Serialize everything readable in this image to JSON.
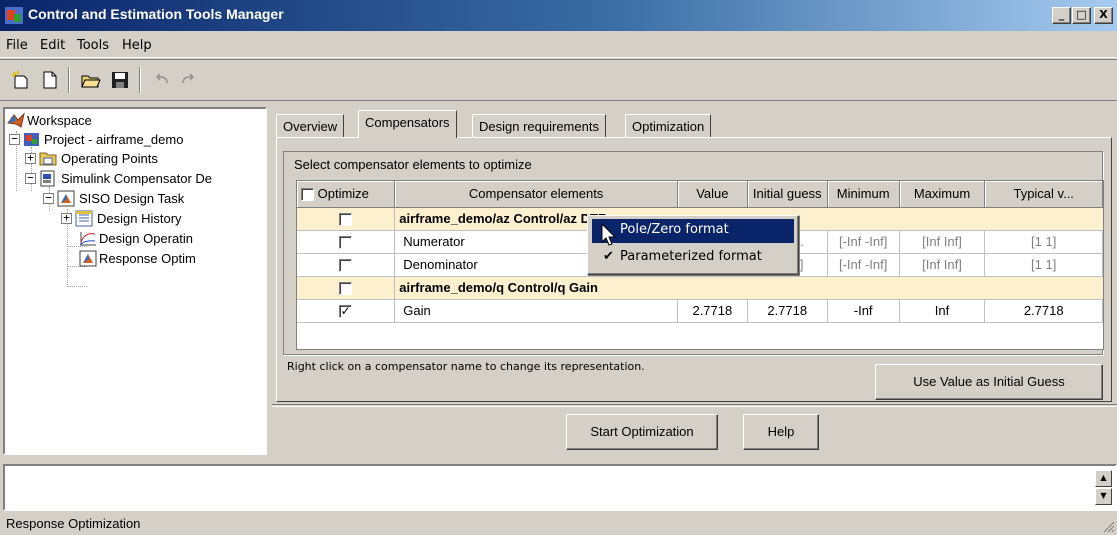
{
  "window": {
    "title": "Control and Estimation Tools Manager",
    "minimize": "_",
    "maximize": "□",
    "close": "X"
  },
  "menu": [
    "File",
    "Edit",
    "Tools",
    "Help"
  ],
  "toolbar": {
    "icons": [
      "new-project-icon",
      "new-document-icon",
      "open-icon",
      "save-icon",
      "undo-icon",
      "redo-icon"
    ]
  },
  "tree": {
    "workspace": "Workspace",
    "project": "Project - airframe_demo",
    "operating_points": "Operating Points",
    "compensator_design": "Simulink Compensator De",
    "siso_task": "SISO Design Task",
    "design_history": "Design History",
    "design_operating": "Design Operatin",
    "response_opt": "Response Optim"
  },
  "tabs": [
    "Overview",
    "Compensators",
    "Design requirements",
    "Optimization"
  ],
  "active_tab": "Compensators",
  "group_title": "Select compensator elements to optimize",
  "table": {
    "headers": [
      "Optimize",
      "Compensator elements",
      "Value",
      "Initial guess",
      "Minimum",
      "Maximum",
      "Typical v..."
    ],
    "block1": "airframe_demo/az Control/az DTF",
    "numerator": {
      "name": "Numerator",
      "initial": "1 -9...",
      "min": "[-Inf -Inf]",
      "max": "[Inf Inf]",
      "typical": "[1 1]"
    },
    "denominator": {
      "name": "Denominator",
      "initial": "8893]",
      "min": "[-Inf -Inf]",
      "max": "[Inf Inf]",
      "typical": "[1 1]"
    },
    "block2": "airframe_demo/q Control/q Gain",
    "gain": {
      "name": "Gain",
      "value": "2.7718",
      "initial": "2.7718",
      "min": "-Inf",
      "max": "Inf",
      "typical": "2.7718",
      "check": "✓"
    }
  },
  "context_menu": {
    "item1": "Pole/Zero format",
    "item2": "Parameterized format",
    "check": "✔"
  },
  "hint": "Right click on a compensator name to change its representation.",
  "buttons": {
    "use_value": "Use Value as Initial Guess",
    "start": "Start Optimization",
    "help": "Help"
  },
  "status": "Response Optimization",
  "colors": {
    "title_gradient_start": "#0a246a",
    "title_gradient_end": "#a6caf0",
    "block_row": "#fcf0cf",
    "menu_highlight": "#0a246a"
  }
}
